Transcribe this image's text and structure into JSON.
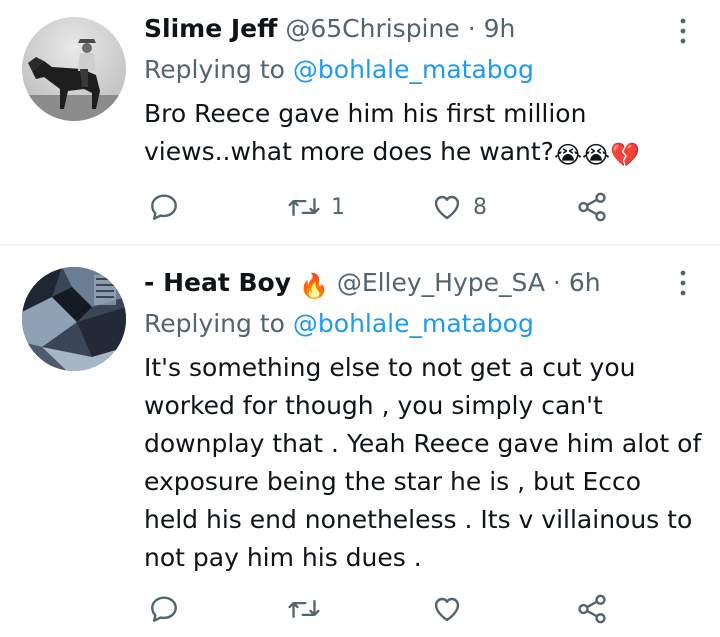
{
  "tweets": [
    {
      "display_name": "Slime Jeff",
      "name_emoji": "",
      "handle": "@65Chrispine",
      "separator": "·",
      "time": "9h",
      "replying_prefix": "Replying to",
      "replying_handle": "@bohlale_matabog",
      "body_lines": [
        "Bro Reece gave him his first million",
        "views..what more does he want?"
      ],
      "body_emojis": "😭😭💔",
      "avatar_icon": "man-on-horse-photo",
      "actions": {
        "reply_count": "",
        "retweet_count": "1",
        "like_count": "8"
      }
    },
    {
      "display_name": "- Heat Boy",
      "name_emoji": "🔥",
      "handle": "@Elley_Hype_SA",
      "separator": "·",
      "time": "6h",
      "replying_prefix": "Replying to",
      "replying_handle": "@bohlale_matabog",
      "body_lines": [
        "It's something else to not get a cut you",
        "worked for though , you simply can't",
        "downplay that . Yeah Reece gave him alot of",
        "exposure being the star he is , but Ecco",
        "held his end nonetheless . Its v villainous to",
        "not pay him his dues ."
      ],
      "avatar_icon": "dark-abstract-photo",
      "actions": {
        "reply_count": "",
        "retweet_count": "",
        "like_count": ""
      }
    }
  ],
  "colors": {
    "text": "#0f1419",
    "secondary": "#536471",
    "link": "#1d9bf0",
    "fire": "#f4900c",
    "divider": "#eff3f4"
  },
  "icons": {
    "more": "more-vertical-icon",
    "reply": "reply-bubble-icon",
    "retweet": "retweet-icon",
    "like": "heart-icon",
    "share": "share-icon"
  }
}
